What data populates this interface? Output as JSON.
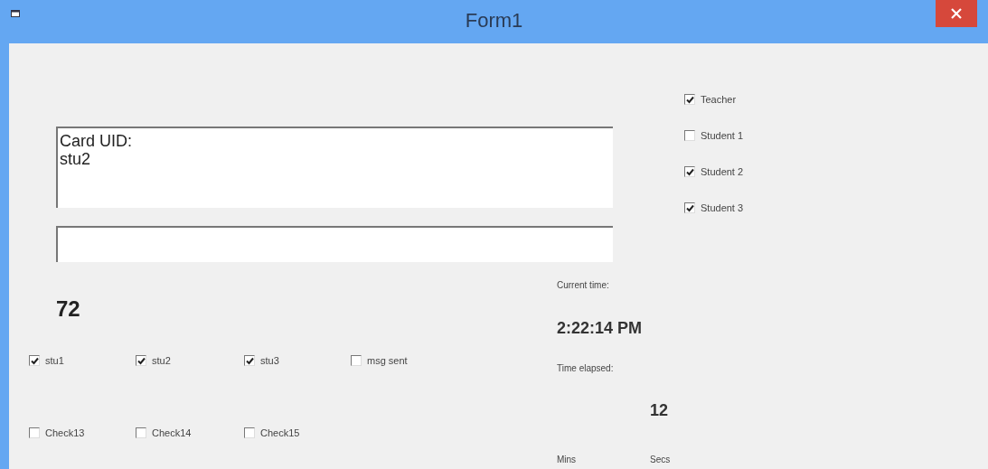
{
  "window": {
    "title": "Form1"
  },
  "log_box": {
    "value": "Card UID:\nstu2"
  },
  "count": "72",
  "student_checks": [
    {
      "label": "stu1",
      "checked": true
    },
    {
      "label": "stu2",
      "checked": true
    },
    {
      "label": "stu3",
      "checked": true
    },
    {
      "label": "msg sent",
      "checked": false
    },
    {
      "label": "Check13",
      "checked": false
    },
    {
      "label": "Check14",
      "checked": false
    },
    {
      "label": "Check15",
      "checked": false
    }
  ],
  "role_checks": [
    {
      "label": "Teacher",
      "checked": true
    },
    {
      "label": "Student 1",
      "checked": false
    },
    {
      "label": "Student 2",
      "checked": true
    },
    {
      "label": "Student 3",
      "checked": true
    }
  ],
  "current_time_label": "Current time:",
  "current_time": "2:22:14 PM",
  "elapsed_label": "Time elapsed:",
  "elapsed_seconds": "12",
  "mins_label": "Mins",
  "secs_label": "Secs"
}
